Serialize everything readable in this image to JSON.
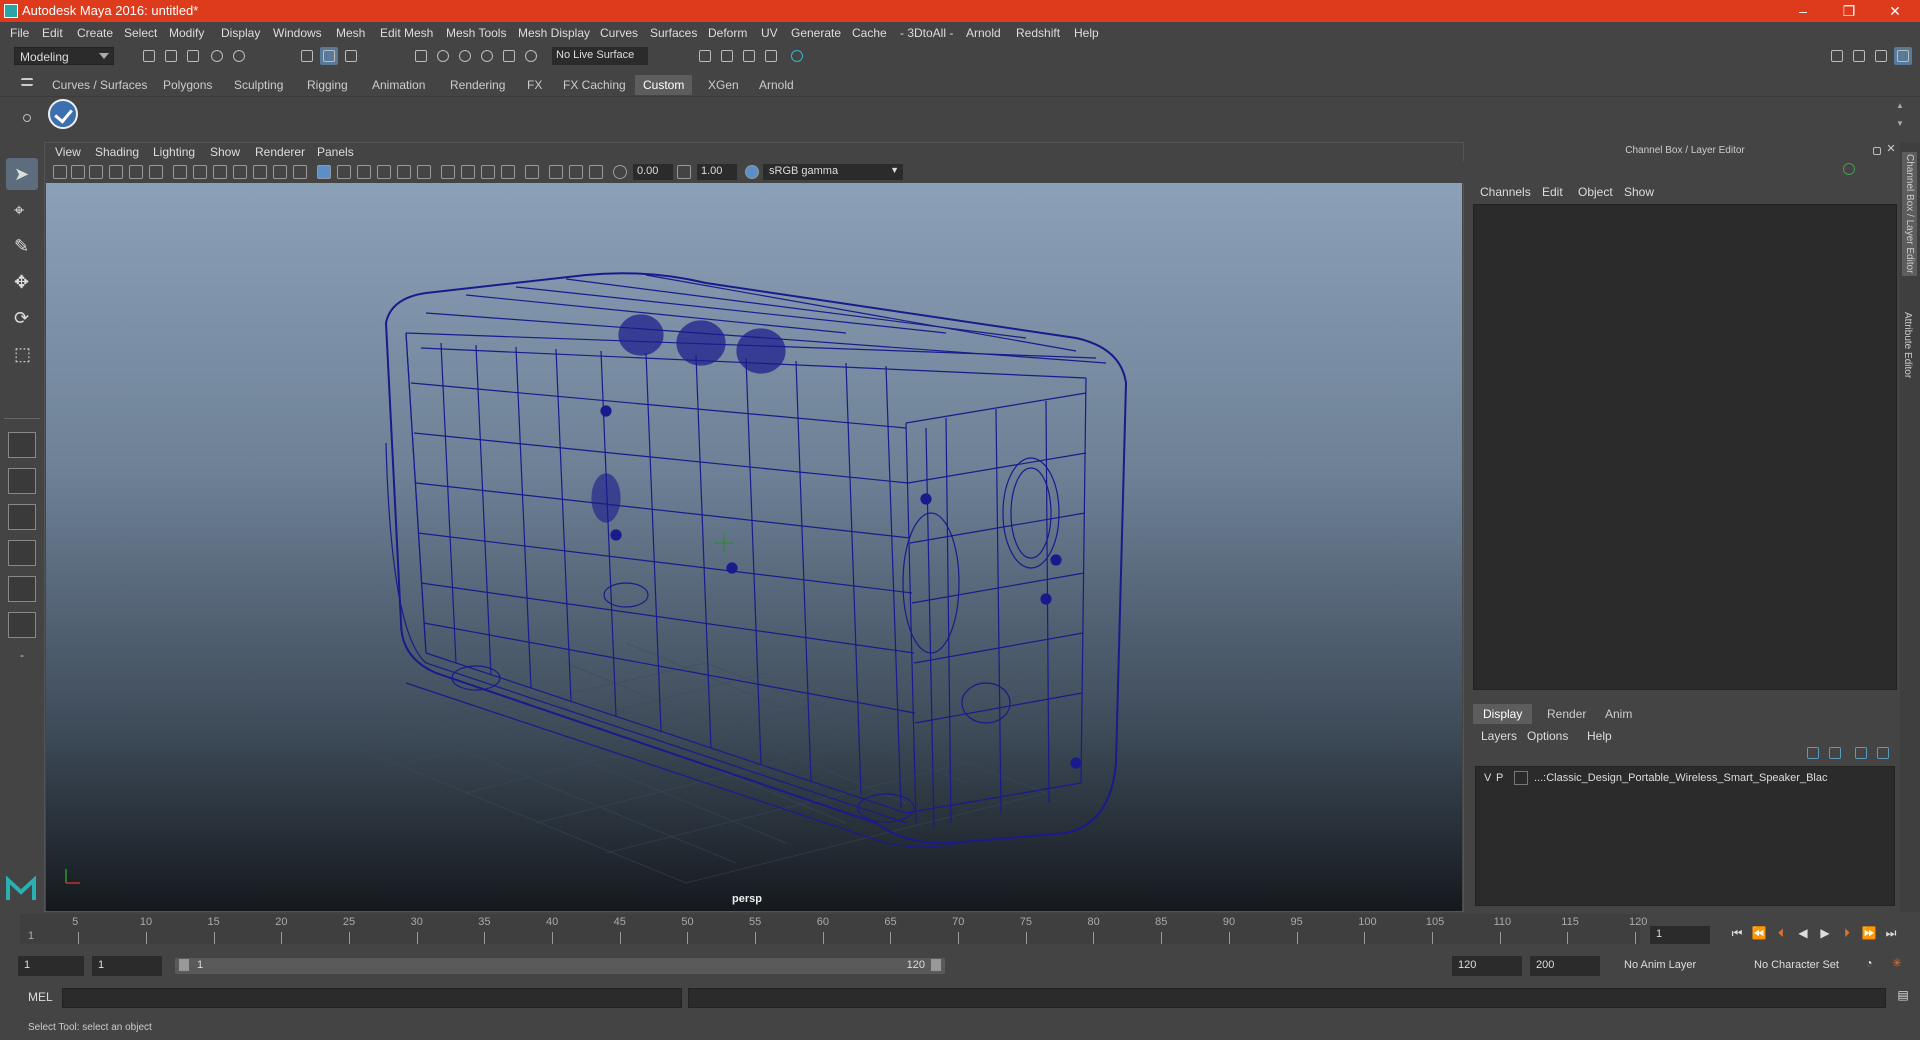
{
  "window": {
    "title": "Autodesk Maya 2016: untitled*",
    "controls": [
      "–",
      "❐",
      "✕"
    ]
  },
  "menubar": [
    "File",
    "Edit",
    "Create",
    "Select",
    "Modify",
    "Display",
    "Windows",
    "Mesh",
    "Edit Mesh",
    "Mesh Tools",
    "Mesh Display",
    "Curves",
    "Surfaces",
    "Deform",
    "UV",
    "Generate",
    "Cache",
    "- 3DtoAll -",
    "Arnold",
    "Redshift",
    "Help"
  ],
  "statusline": {
    "mode": "Modeling",
    "live_surface": "No Live Surface"
  },
  "shelf_tabs": [
    "Curves / Surfaces",
    "Polygons",
    "Sculpting",
    "Rigging",
    "Animation",
    "Rendering",
    "FX",
    "FX Caching",
    "Custom",
    "XGen",
    "Arnold"
  ],
  "shelf_active": "Custom",
  "panel_menu": [
    "View",
    "Shading",
    "Lighting",
    "Show",
    "Renderer",
    "Panels"
  ],
  "panel_tools": {
    "exposure": "0.00",
    "gamma": "1.00",
    "color_space": "sRGB gamma"
  },
  "viewport": {
    "camera": "persp",
    "wire_color": "#1a1a8c"
  },
  "channel_box": {
    "title": "Channel Box / Layer Editor",
    "menu": [
      "Channels",
      "Edit",
      "Object",
      "Show"
    ]
  },
  "layer_editor": {
    "tabs": [
      "Display",
      "Render",
      "Anim"
    ],
    "active_tab": "Display",
    "menu": [
      "Layers",
      "Options",
      "Help"
    ],
    "layer": {
      "v": "V",
      "p": "P",
      "name": "...:Classic_Design_Portable_Wireless_Smart_Speaker_Blac"
    }
  },
  "side_tabs": [
    "Channel Box / Layer Editor",
    "Attribute Editor"
  ],
  "timeline": {
    "ticks": [
      5,
      10,
      15,
      20,
      25,
      30,
      35,
      40,
      45,
      50,
      55,
      60,
      65,
      70,
      75,
      80,
      85,
      90,
      95,
      100,
      105,
      110,
      115,
      120
    ],
    "start_label": "1",
    "current_frame": "1"
  },
  "range": {
    "start": "1",
    "anim_start": "1",
    "slider_start": "1",
    "slider_end": "120",
    "anim_end": "120",
    "end": "200",
    "anim_layer": "No Anim Layer",
    "char_set": "No Character Set"
  },
  "cmd": {
    "label": "MEL"
  },
  "help_line": "Select Tool: select an object"
}
